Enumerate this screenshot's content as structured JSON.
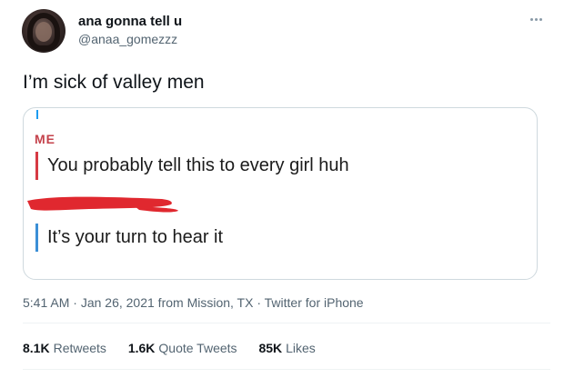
{
  "author": {
    "display_name": "ana gonna tell u",
    "handle": "@anaa_gomezzz"
  },
  "tweet": {
    "text": "I’m sick of valley men"
  },
  "media": {
    "me_label": "ME",
    "message_me": "You probably tell this to every girl huh",
    "message_reply": "It’s your turn to hear it",
    "redaction_color": "#e0282f",
    "me_bar_color": "#d63a44",
    "reply_bar_color": "#3b8fd6"
  },
  "meta": {
    "time": "5:41 AM",
    "separator": " · ",
    "date": "Jan 26, 2021",
    "location": " from Mission, TX",
    "source": "Twitter for iPhone"
  },
  "stats": {
    "retweets_count": "8.1K",
    "retweets_label": "Retweets",
    "quotes_count": "1.6K",
    "quotes_label": "Quote Tweets",
    "likes_count": "85K",
    "likes_label": "Likes"
  },
  "icons": {
    "more": "more-horizontal-icon"
  }
}
